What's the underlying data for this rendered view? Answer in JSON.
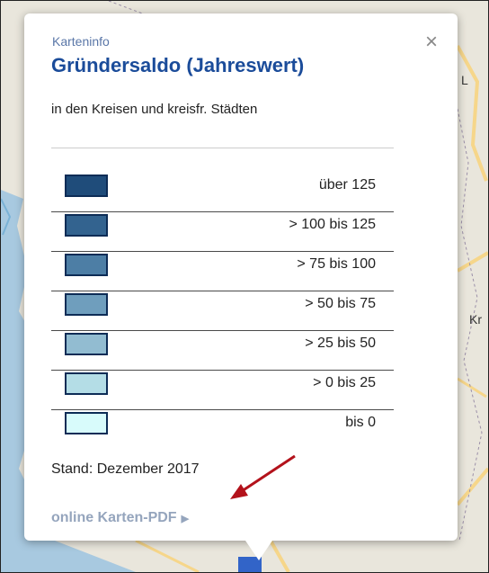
{
  "map": {
    "labels": [
      "L",
      "Kr"
    ],
    "colors": {
      "land": "#e9e6dc",
      "water": "#a8c9e0",
      "river": "#7ab2d6",
      "road": "#f6d68a",
      "pointer": "#3264c8"
    }
  },
  "popup": {
    "kicker": "Karteninfo",
    "title": "Gründersaldo (Jahreswert)",
    "subtitle": "in den Kreisen und kreisfr. Städten",
    "close_label": "×",
    "legend": [
      {
        "label": "über 125",
        "color": "#1f4c7a"
      },
      {
        "label": "> 100 bis 125",
        "color": "#33638f"
      },
      {
        "label": "> 75 bis 100",
        "color": "#4d7ea5"
      },
      {
        "label": "> 50 bis 75",
        "color": "#6f9ebd"
      },
      {
        "label": "> 25 bis 50",
        "color": "#92bcd1"
      },
      {
        "label": "> 0 bis 25",
        "color": "#b4dde6"
      },
      {
        "label": "bis 0",
        "color": "#d8fbfb"
      }
    ],
    "stand": "Stand: Dezember 2017",
    "pdf_link": "online Karten-PDF"
  },
  "annotation": {
    "arrow_color": "#b3121b"
  }
}
